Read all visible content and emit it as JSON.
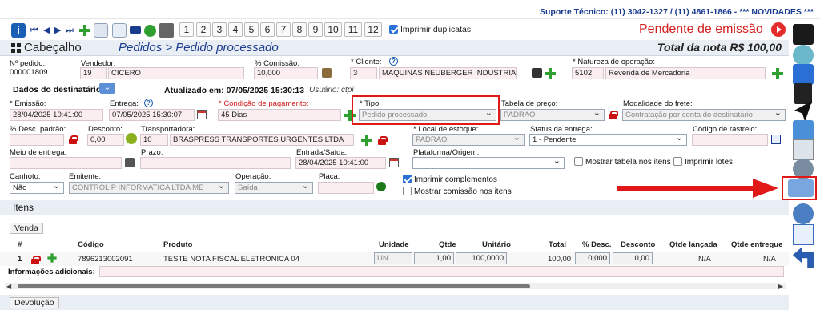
{
  "topbar": {
    "support": "Suporte Técnico: (11) 3042-1327 / (11) 4861-1866 - *** NOVIDADES ***"
  },
  "toolbar": {
    "pages": [
      "1",
      "2",
      "3",
      "4",
      "5",
      "6",
      "7",
      "8",
      "9",
      "10",
      "11",
      "12"
    ],
    "dup_label": "Imprimir duplicatas"
  },
  "status": "Pendente de emissão",
  "header": {
    "title": "Cabeçalho",
    "breadcrumb": "Pedidos > Pedido processado",
    "total": "Total da nota R$ 100,00"
  },
  "form": {
    "pedido_label": "Nº pedido:",
    "pedido": "000001809",
    "vendedor_label": "Vendedor:",
    "vendedor_id": "19",
    "vendedor": "CICERO",
    "comissao_label": "% Comissão:",
    "comissao": "10,000",
    "cliente_label": "* Cliente:",
    "cliente_id": "3",
    "cliente": "MAQUINAS NEUBERGER INDUSTRIA E",
    "natureza_label": "* Natureza de operação:",
    "natureza_id": "5102",
    "natureza": "Revenda de Mercadoria",
    "dados_dest": "Dados do destinatário",
    "atualizado": "Atualizado em: 07/05/2025 15:30:13",
    "usuario": "Usuário: ctpi",
    "emissao_label": "* Emissão:",
    "emissao": "28/04/2025 10:41:00",
    "entrega_label": "Entrega:",
    "entrega": "07/05/2025 15:30:07",
    "cond_label": "* Condição de pagamento:",
    "cond": "45 Dias",
    "tipo_label": "* Tipo:",
    "tipo": "Pedido processado",
    "tabela_label": "Tabela de preço:",
    "tabela": "PADRAO",
    "frete_label": "Modalidade do frete:",
    "frete": "Contratação por conta do destinatário",
    "desc_label": "% Desc. padrão:",
    "desconto_label": "Desconto:",
    "desconto": "0,00",
    "transp_label": "Transportadora:",
    "transp_id": "10",
    "transp": "BRASPRESS TRANSPORTES URGENTES LTDA",
    "local_label": "* Local de estoque:",
    "local": "PADRAO",
    "status_label": "Status da entrega:",
    "status_ent": "1 - Pendente",
    "rastreio_label": "Código de rastreio:",
    "meio_label": "Meio de entrega:",
    "prazo_label": "Prazo:",
    "entrada_label": "Entrada/Saída:",
    "entrada": "28/04/2025 10:41:00",
    "plataforma_label": "Plataforma/Origem:",
    "mostrar_tabela": "Mostrar tabela nos itens",
    "imprimir_lotes": "Imprimir lotes",
    "canhoto_label": "Canhoto:",
    "canhoto": "Não",
    "emitente_label": "Emitente:",
    "emitente": "CONTROL P INFORMATICA LTDA ME",
    "operacao_label": "Operação:",
    "operacao": "Saída",
    "placa_label": "Placa:",
    "imprimir_compl": "Imprimir complementos",
    "mostrar_comissao": "Mostrar comissão nos itens"
  },
  "itens": {
    "title": "Itens",
    "venda_tab": "Venda",
    "devolucao_tab": "Devolução",
    "columns": [
      "#",
      "Código",
      "Produto",
      "Unidade",
      "Qtde",
      "Unitário",
      "Total",
      "% Desc.",
      "Desconto",
      "Qtde lançada",
      "Qtde entregue"
    ],
    "row": {
      "n": "1",
      "codigo": "7896213002091",
      "produto": "TESTE NOTA FISCAL ELETRONICA 04",
      "unidade": "UN",
      "qtde": "1,00",
      "unitario": "100,0000",
      "total": "100,00",
      "desc_pct": "0,000",
      "desconto": "0,00",
      "lancada": "N/A",
      "entregue": "N/A"
    },
    "info_label": "Informações adicionais:"
  }
}
